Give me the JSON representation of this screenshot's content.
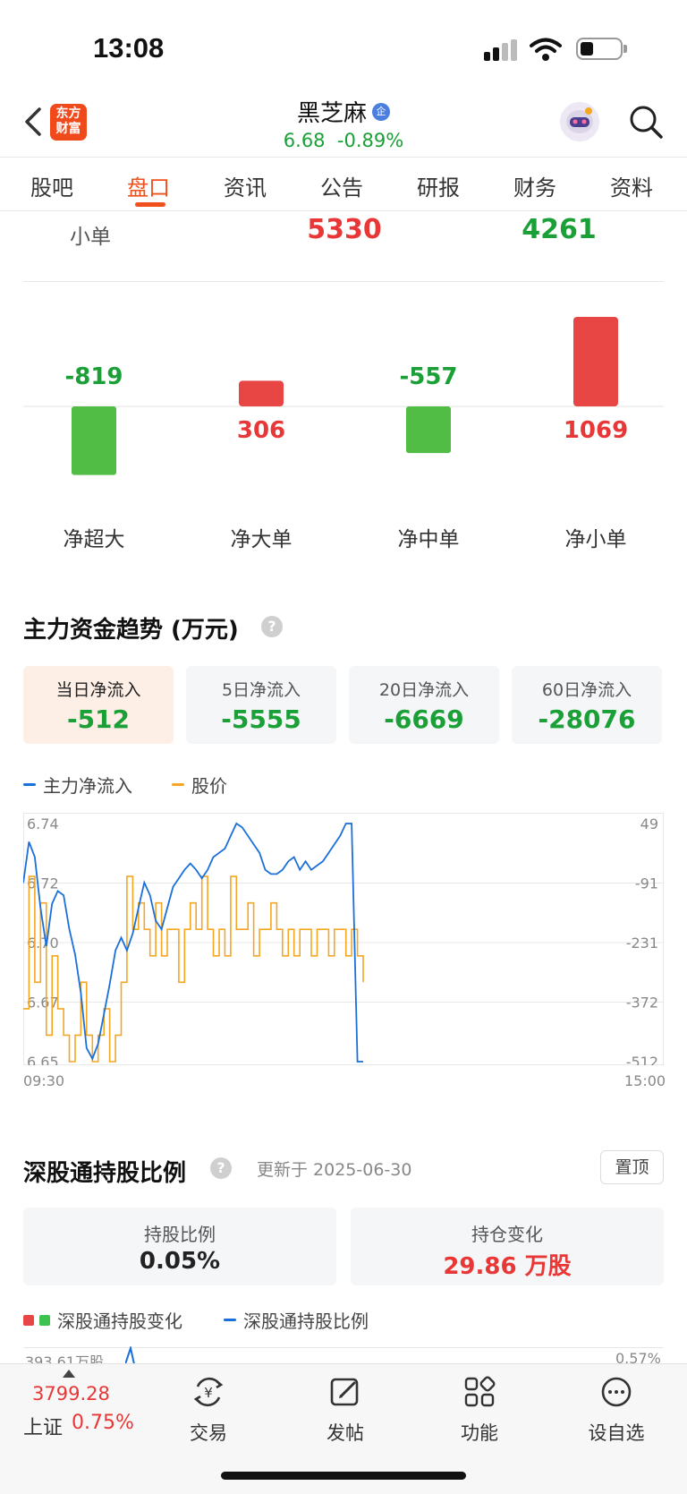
{
  "status_bar": {
    "time": "13:08"
  },
  "header": {
    "logo_line1": "东方",
    "logo_line2": "财富",
    "stock_name": "黑芝麻",
    "badge": "企",
    "price": "6.68",
    "change_pct": "-0.89%"
  },
  "tabs": [
    {
      "label": "股吧"
    },
    {
      "label": "盘口",
      "active": true
    },
    {
      "label": "资讯"
    },
    {
      "label": "公告"
    },
    {
      "label": "研报"
    },
    {
      "label": "财务"
    },
    {
      "label": "资料"
    }
  ],
  "small_order_row": {
    "label": "小单",
    "inflow": "5330",
    "outflow": "4261"
  },
  "net_flow_chart": {
    "type": "bar",
    "categories": [
      "净超大",
      "净大单",
      "净中单",
      "净小单"
    ],
    "values": [
      -819,
      306,
      -557,
      1069
    ],
    "value_labels": [
      "-819",
      "306",
      "-557",
      "1069"
    ]
  },
  "main_trend": {
    "title": "主力资金趋势 (万元)",
    "help": "?",
    "cards": [
      {
        "label": "当日净流入",
        "value": "-512",
        "active": true
      },
      {
        "label": "5日净流入",
        "value": "-5555"
      },
      {
        "label": "20日净流入",
        "value": "-6669"
      },
      {
        "label": "60日净流入",
        "value": "-28076"
      }
    ],
    "legend": [
      {
        "name": "主力净流入",
        "color": "#1a6fdb"
      },
      {
        "name": "股价",
        "color": "#f5a623"
      }
    ]
  },
  "chart_data": {
    "type": "line",
    "x_labels": [
      "09:30",
      "15:00"
    ],
    "y_left_ticks": [
      "6.74",
      "6.72",
      "6.70",
      "6.67",
      "6.65"
    ],
    "y_right_ticks": [
      "49",
      "-91",
      "-231",
      "-372",
      "-512"
    ],
    "y_left_range": [
      6.65,
      6.74
    ],
    "y_right_range": [
      -512,
      49
    ],
    "grid": true,
    "series": [
      {
        "name": "主力净流入",
        "color": "#1a6fdb",
        "values": [
          -91,
          6,
          -30,
          -150,
          -240,
          -140,
          -110,
          -120,
          -200,
          -260,
          -350,
          -480,
          -505,
          -470,
          -400,
          -330,
          -250,
          -220,
          -250,
          -210,
          -150,
          -90,
          -120,
          -180,
          -200,
          -150,
          -100,
          -80,
          -60,
          -45,
          -60,
          -80,
          -60,
          -30,
          -20,
          -10,
          20,
          49,
          40,
          20,
          0,
          -20,
          -60,
          -70,
          -70,
          -60,
          -40,
          -30,
          -60,
          -40,
          -60,
          -50,
          -40,
          -20,
          0,
          20,
          49,
          49,
          -512,
          -512
        ]
      },
      {
        "name": "股价",
        "color": "#f5a623",
        "values": [
          6.67,
          6.72,
          6.68,
          6.71,
          6.66,
          6.69,
          6.67,
          6.66,
          6.65,
          6.66,
          6.68,
          6.66,
          6.65,
          6.66,
          6.67,
          6.65,
          6.66,
          6.68,
          6.72,
          6.7,
          6.71,
          6.7,
          6.69,
          6.71,
          6.69,
          6.7,
          6.7,
          6.68,
          6.7,
          6.71,
          6.7,
          6.72,
          6.7,
          6.69,
          6.7,
          6.69,
          6.72,
          6.7,
          6.7,
          6.71,
          6.69,
          6.7,
          6.7,
          6.71,
          6.7,
          6.69,
          6.7,
          6.69,
          6.7,
          6.7,
          6.69,
          6.7,
          6.7,
          6.69,
          6.7,
          6.7,
          6.69,
          6.7,
          6.69,
          6.68
        ]
      }
    ]
  },
  "hk_holding": {
    "title": "深股通持股比例",
    "help": "?",
    "updated": "更新于 2025-06-30",
    "pin_label": "置顶",
    "hold_ratio_label": "持股比例",
    "hold_ratio_value": "0.05%",
    "position_change_label": "持仓变化",
    "position_change_value": "29.86 万股",
    "legend_change": "深股通持股变化",
    "legend_ratio": "深股通持股比例",
    "axis_left_top": "393.61万股",
    "axis_right_top": "0.57%"
  },
  "bottom_bar": {
    "index_value": "3799.28",
    "index_name": "上证",
    "index_pct": "0.75%",
    "nav": [
      {
        "label": "交易",
        "icon": "trade-icon"
      },
      {
        "label": "发帖",
        "icon": "compose-icon"
      },
      {
        "label": "功能",
        "icon": "apps-icon"
      },
      {
        "label": "设自选",
        "icon": "more-icon"
      }
    ]
  }
}
